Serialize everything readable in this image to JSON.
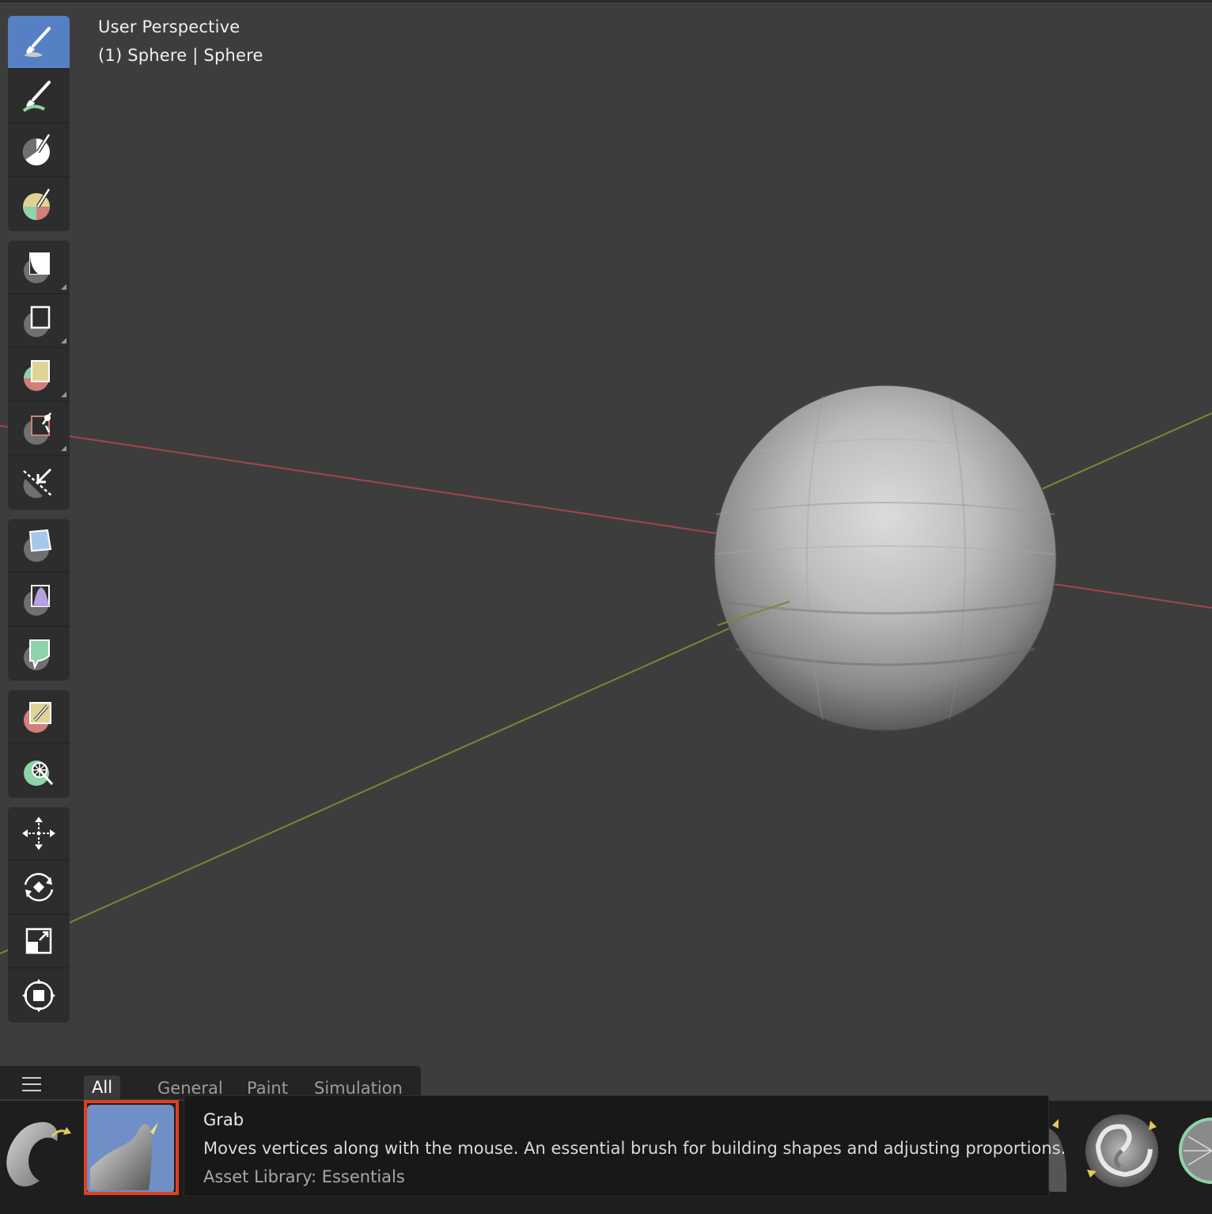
{
  "viewport": {
    "perspective_label": "User Perspective",
    "object_label": "(1) Sphere | Sphere"
  },
  "toolbar": {
    "groups": [
      [
        {
          "name": "brush-draw",
          "active": true
        },
        {
          "name": "brush-smooth"
        },
        {
          "name": "brush-mask"
        },
        {
          "name": "brush-face-sets"
        }
      ],
      [
        {
          "name": "box-mask"
        },
        {
          "name": "box-hide"
        },
        {
          "name": "box-face-set"
        },
        {
          "name": "box-trim"
        },
        {
          "name": "line-project"
        }
      ],
      [
        {
          "name": "mesh-filter"
        },
        {
          "name": "cloth-filter"
        },
        {
          "name": "color-filter"
        }
      ],
      [
        {
          "name": "edit-face-set"
        },
        {
          "name": "mask-by-color"
        }
      ],
      [
        {
          "name": "move"
        },
        {
          "name": "rotate"
        },
        {
          "name": "scale"
        },
        {
          "name": "transform"
        }
      ]
    ]
  },
  "asset_shelf": {
    "tabs": [
      "All",
      "General",
      "Paint",
      "Simulation"
    ],
    "active_tab": "All"
  },
  "tooltip": {
    "title": "Grab",
    "description": "Moves vertices along with the mouse. An essential brush for building shapes and adjusting proportions.",
    "library": "Asset Library: Essentials"
  },
  "colors": {
    "viewport_bg": "#3d3d3d",
    "x_axis": "#a4454f",
    "y_axis": "#6f8e35",
    "active_tool": "#5580c4",
    "selection_outline": "#e0401e"
  }
}
